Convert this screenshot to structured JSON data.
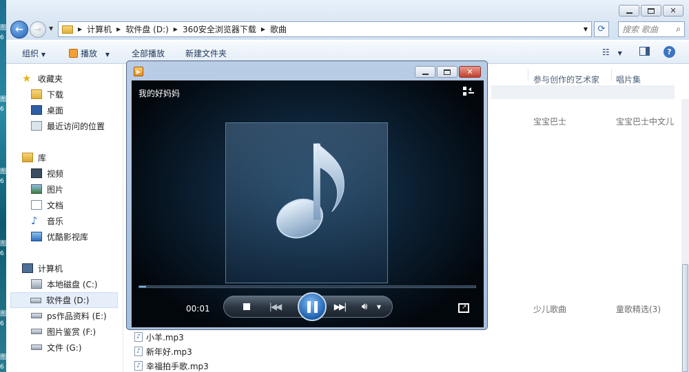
{
  "desktop": {
    "edge_labels": [
      "图",
      "6",
      "图",
      "6",
      "图",
      "6",
      "图",
      "6",
      "图",
      "6",
      "图",
      "6"
    ]
  },
  "explorer": {
    "breadcrumbs": [
      "计算机",
      "软件盘 (D:)",
      "360安全浏览器下载",
      "歌曲"
    ],
    "search_placeholder": "搜索 歌曲",
    "toolbar": {
      "organize": "组织",
      "play": "播放",
      "play_all": "全部播放",
      "new_folder": "新建文件夹"
    },
    "sidebar": {
      "favorites_header": "收藏夹",
      "favorites": [
        "下载",
        "桌面",
        "最近访问的位置"
      ],
      "libraries_header": "库",
      "libraries": [
        "视频",
        "图片",
        "文档",
        "音乐",
        "优酷影视库"
      ],
      "computer_header": "计算机",
      "drives": [
        "本地磁盘 (C:)",
        "软件盘 (D:)",
        "ps作品资料 (E:)",
        "图片鉴赏 (F:)",
        "文件 (G:)"
      ]
    },
    "columns": [
      "参与创作的艺术家",
      "唱片集"
    ],
    "rows": [
      {
        "artist": "宝宝巴士",
        "album": "宝宝巴士中文儿"
      },
      {
        "artist": "少儿歌曲",
        "album": "童歌精选(3)"
      }
    ],
    "files": [
      "小羊.mp3",
      "新年好.mp3",
      "幸福拍手歌.mp3"
    ]
  },
  "player": {
    "song_title": "我的好妈妈",
    "elapsed": "00:01",
    "progress": 0.02
  },
  "colors": {
    "accent": "#2461b4",
    "player_frame": "#b9cde6",
    "close_button": "#c4402e"
  }
}
